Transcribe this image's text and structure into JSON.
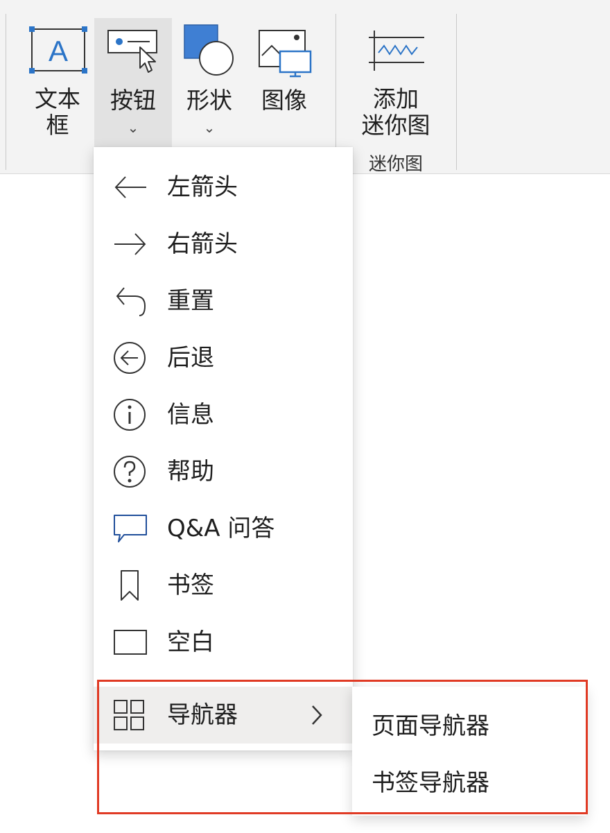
{
  "ribbon": {
    "buttons": [
      {
        "label_line1": "文本",
        "label_line2": "框",
        "icon": "textbox-icon"
      },
      {
        "label": "按钮",
        "icon": "button-icon",
        "chevron": "⌄"
      },
      {
        "label": "形状",
        "icon": "shapes-icon",
        "chevron": "⌄"
      },
      {
        "label": "图像",
        "icon": "image-icon"
      },
      {
        "label_line1": "添加",
        "label_line2": "迷你图",
        "icon": "sparkline-icon"
      }
    ],
    "groups": [
      {
        "label": "迷你图"
      }
    ]
  },
  "menu": {
    "items": [
      {
        "label": "左箭头",
        "icon": "left-arrow-icon"
      },
      {
        "label": "右箭头",
        "icon": "right-arrow-icon"
      },
      {
        "label": "重置",
        "icon": "reset-icon"
      },
      {
        "label": "后退",
        "icon": "back-circle-icon"
      },
      {
        "label": "信息",
        "icon": "info-icon"
      },
      {
        "label": "帮助",
        "icon": "help-icon"
      },
      {
        "label": "Q&A 问答",
        "icon": "qa-icon"
      },
      {
        "label": "书签",
        "icon": "bookmark-icon"
      },
      {
        "label": "空白",
        "icon": "blank-icon"
      },
      {
        "label": "导航器",
        "icon": "navigator-grid-icon",
        "has_submenu": true
      }
    ]
  },
  "submenu": {
    "items": [
      {
        "label": "页面导航器"
      },
      {
        "label": "书签导航器"
      }
    ]
  },
  "colors": {
    "accent_blue": "#2b74c7",
    "highlight_red": "#e03a24"
  }
}
